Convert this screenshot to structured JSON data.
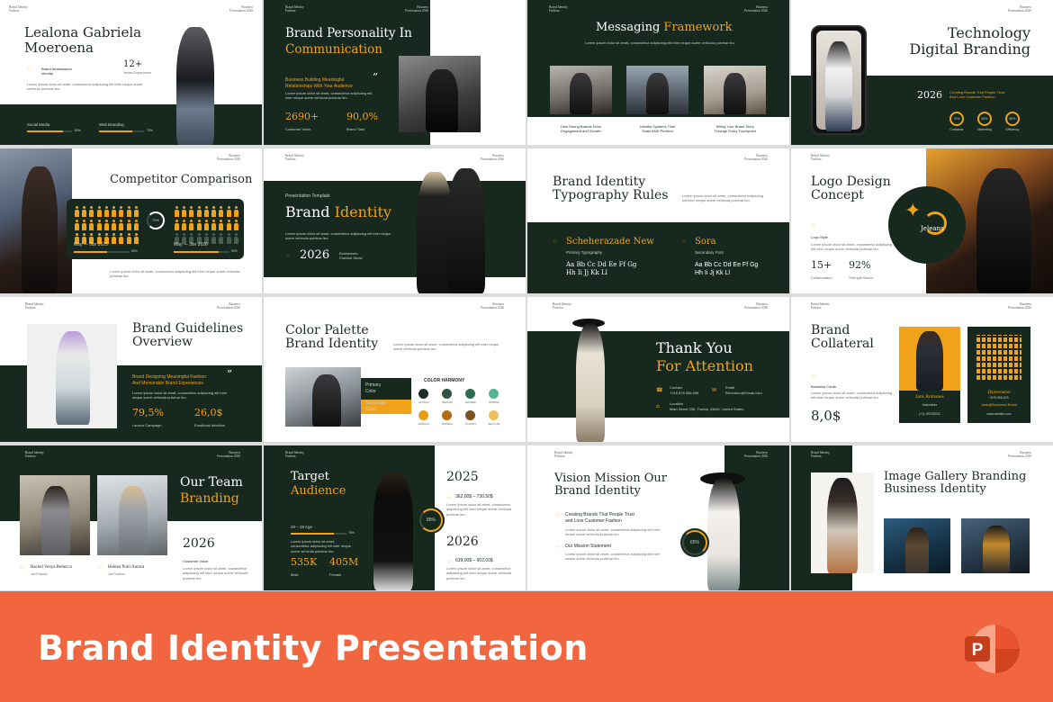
{
  "banner": {
    "title": "Brand Identity Presentation",
    "icon": "powerpoint-icon",
    "icon_letter": "P"
  },
  "header_common": {
    "left": "Brand Identity\nFashion",
    "right": "Business\nPresentation 2026"
  },
  "lorem": "Lorem ipsum dolor sit amet, consectetur adipiscing elit inter neque suere vehicula pulvinar leo.",
  "s1": {
    "name": "Lealona Gabriela\nMoeroena",
    "role": "Brand Ambassador\nIdentity",
    "years": "12+",
    "years_label": "Years Experience",
    "bar1_label": "Social Media",
    "bar1_value": "80%",
    "bar1_fraction": 0.8,
    "bar2_label": "Web Branding",
    "bar2_value": "75%",
    "bar2_fraction": 0.75
  },
  "s2": {
    "title1": "Brand Personality In",
    "title2": "Communication",
    "sub": "Business Building Meaningful\nRelationships With Your Audience",
    "quote": "”",
    "stat1": "2690+",
    "stat1_label": "Customer Voice",
    "stat2": "90,0%",
    "stat2_label": "Brand Tone"
  },
  "s3": {
    "title1": "Messaging",
    "title2": "Framework",
    "cap1": "How Strong Brands Drive\nEngagement and Growth",
    "cap2": "Identity Systems That\nScale AND Perform",
    "cap3": "Telling Your Brand Story\nThrough Every Touchpoint"
  },
  "s4": {
    "title": "Technology\nDigital Branding",
    "year": "2026",
    "tag": "Creating Brands That People Trust\nAnd Love Customer Fashion",
    "r1": "70%",
    "r1_label": "Customer",
    "r2": "50%",
    "r2_label": "Marketing",
    "r3": "80%",
    "r3_label": "Efficiency"
  },
  "s5": {
    "title": "Competitor Comparison",
    "center": "70%",
    "l1": "May — Jun 2025",
    "l2": "May — Jun  2026",
    "v1": "60%",
    "v2": "80%"
  },
  "s6": {
    "kicker": "Presentation Template",
    "title1": "Brand",
    "title2": "Identity",
    "year": "2026",
    "event": "Businesses\nFashion Show"
  },
  "s7": {
    "title": "Brand Identity\nTypography Rules",
    "f1": "Scheherazade New",
    "f1_label": "Primary Typography",
    "f2": "Sora",
    "f2_label": "Secondary Font",
    "alpha1": "Aa Bb Cc Dd Ee Ff Gg\nHh Ii Jj Kk Ll",
    "alpha2": "Aa Bb Cc Dd Ee Ff Gg\nHh Ii Jj Kk Ll"
  },
  "s8": {
    "title": "Logo Design\nConcept",
    "style_label": "Logo Style",
    "stat1": "15+",
    "stat1_label": "Collaboration",
    "stat2": "92%",
    "stat2_label": "Strength Brand",
    "logo_text": "Jeleans"
  },
  "s9": {
    "title": "Brand Guidelines\nOverview",
    "sub": "Brand Designing Meaningful Fashion\nAnd Memorable Brand Experiences",
    "stat1": "79,5%",
    "stat1_label": "Launch Campaign",
    "stat2": "26,0$",
    "stat2_label": "Emotional direction"
  },
  "s10": {
    "title": "Color Palette\nBrand Identity",
    "primary": "Primary\nColor",
    "secondary": "Secondary\nColor",
    "harmony": "COLOR HARMONY",
    "swatches": [
      {
        "color": "#1b2f25",
        "hex": "#17291F"
      },
      {
        "color": "#2e5440",
        "hex": "#2E5440"
      },
      {
        "color": "#2f6b4f",
        "hex": "#2F6B4F"
      },
      {
        "color": "#56b592",
        "hex": "#56B592"
      },
      {
        "color": "#e89a1a",
        "hex": "#E89A1A"
      },
      {
        "color": "#b36b14",
        "hex": "#B36B14"
      },
      {
        "color": "#7a5521",
        "hex": "#7A5521"
      },
      {
        "color": "#efc15e",
        "hex": "#EFC15E"
      }
    ]
  },
  "s11": {
    "title1": "Thank You",
    "title2": "For Attention",
    "contact_label": "Contact",
    "contact": "+216 876 556 098",
    "email_label": "Email",
    "email": "Elecrolino@Gmail.com",
    "loc_label": "Location",
    "loc": "Main Street 235, Florida, 33801, United States"
  },
  "s12": {
    "title": "Brand\nCollateral",
    "cards_label": "Business Cards",
    "price": "8,0$",
    "card_name": "Jack Romanes",
    "card_role": "Volunteer",
    "card_phone": "(+1) 190299211",
    "qr_user": "@Username",
    "qr_phone": "+875-908-876",
    "qr_brand": "Jack@Business Brand",
    "qr_site": "www.website.com"
  },
  "s13": {
    "title1": "Our Team",
    "title2": "Branding",
    "year": "2026",
    "year_label": "Customer Voice",
    "m1": "Rachel Venya Rebecca",
    "m1_role": "Job Position",
    "m2": "Helena Putri Aurora",
    "m2_role": "Job Position"
  },
  "s14": {
    "title1": "Target",
    "title2": "Audience",
    "age": "20 – 28 Age",
    "age_pct": "78%",
    "age_fraction": 0.78,
    "ring": "85%",
    "y1": "2025",
    "y1_range": "362,00$ – 730,50$",
    "y2": "2026",
    "y2_range": "639,00$ – 902,00$",
    "male": "535K",
    "male_label": "Male",
    "female": "405M",
    "female_label": "Female"
  },
  "s15": {
    "title": "Vision Mission Our\nBrand Identity",
    "vision": "Creating Brands That People Trust\nand Love Customer Fashion",
    "mission": "Our Mission Statement",
    "ring": "65%"
  },
  "s16": {
    "title": "Image Gallery Branding\nBusiness Identity"
  }
}
